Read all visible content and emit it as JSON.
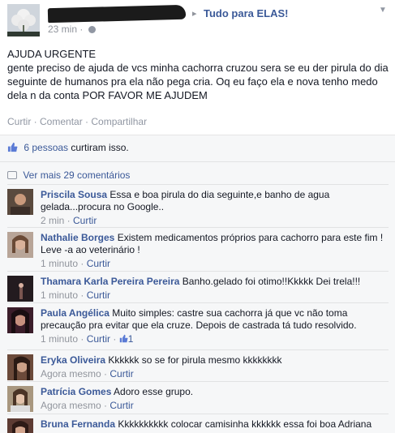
{
  "post": {
    "group_arrow": "▸",
    "group": "Tudo para ELAS!",
    "time": "23 min",
    "separator": "·",
    "body": "AJUDA URGENTE\ngente preciso de ajuda de vcs minha cachorra cruzou sera se eu der pirula do dia seguinte de humanos pra ela não pega cria. Oq eu faço ela e nova tenho medo dela n da conta POR FAVOR ME AJUDEM",
    "actions": {
      "like": "Curtir",
      "comment": "Comentar",
      "share": "Compartilhar",
      "sep": " · "
    }
  },
  "likes": {
    "count": "6 pessoas",
    "suffix": " curtiram isso."
  },
  "more_comments": "Ver mais 29 comentários",
  "comments": [
    {
      "author": "Priscila Sousa",
      "text": "Essa e boa pirula do dia seguinte,e banho de agua gelada...procura no Google..",
      "time": "2 min",
      "like": "Curtir",
      "avatar_color": "#5a4a3e"
    },
    {
      "author": "Nathalie Borges",
      "text": "Existem medicamentos próprios para cachorro para este fim ! Leve -a ao veterinário !",
      "time": "1 minuto",
      "like": "Curtir",
      "avatar_color": "#8a6a55"
    },
    {
      "author": "Thamara Karla Pereira Pereira",
      "text": "Banho.gelado foi otimo!!Kkkkk Dei trela!!!",
      "time": "1 minuto",
      "like": "Curtir",
      "avatar_color": "#2a2226"
    },
    {
      "author": "Paula Angélica",
      "text": "Muito simples: castre sua cachorra já que vc não toma precaução pra evitar que ela cruze. Depois de castrada tá tudo resolvido.",
      "time": "1 minuto",
      "like": "Curtir",
      "likes": "1",
      "avatar_color": "#3b1d2a"
    },
    {
      "author": "Eryka Oliveira",
      "text": "Kkkkkk so se for pirula mesmo kkkkkkkk",
      "time": "Agora mesmo",
      "like": "Curtir",
      "avatar_color": "#6b4a3a"
    },
    {
      "author": "Patrícia Gomes",
      "text": "Adoro esse grupo.",
      "time": "Agora mesmo",
      "like": "Curtir",
      "avatar_color": "#a8977f"
    },
    {
      "author": "Bruna Fernanda",
      "text": "Kkkkkkkkkk colocar camisinha kkkkkk essa foi boa Adriana",
      "time": "",
      "like": "",
      "avatar_color": "#5d3b33"
    }
  ],
  "colors": {
    "link": "#3b5998",
    "meta": "#90949c",
    "ufi_bg": "#f6f7f8"
  }
}
